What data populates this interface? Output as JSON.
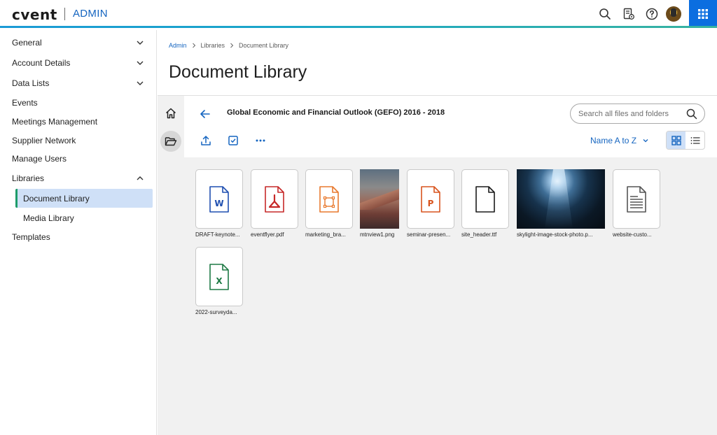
{
  "header": {
    "logo": "cvent",
    "section": "ADMIN",
    "icons": [
      "search-icon",
      "report-settings-icon",
      "help-icon",
      "avatar",
      "apps-grid-icon"
    ]
  },
  "sidebar": {
    "items": [
      {
        "label": "General",
        "expandable": true,
        "expanded": false
      },
      {
        "label": "Account Details",
        "expandable": true,
        "expanded": false
      },
      {
        "label": "Data Lists",
        "expandable": true,
        "expanded": false
      },
      {
        "label": "Events"
      },
      {
        "label": "Meetings Management"
      },
      {
        "label": "Supplier Network"
      },
      {
        "label": "Manage Users"
      },
      {
        "label": "Libraries",
        "expandable": true,
        "expanded": true
      },
      {
        "label": "Templates"
      }
    ],
    "library_children": [
      {
        "label": "Document Library",
        "active": true
      },
      {
        "label": "Media Library",
        "active": false
      }
    ]
  },
  "breadcrumb": [
    "Admin",
    "Libraries",
    "Document Library"
  ],
  "page_title": "Document Library",
  "folder": {
    "title": "Global Economic and Financial Outlook (GEFO) 2016 - 2018",
    "search_placeholder": "Search all files and folders",
    "sort_label": "Name A to Z",
    "view_mode": "grid"
  },
  "files": [
    {
      "name": "DRAFT-keynote...",
      "type": "word",
      "color": "#1f4fb0"
    },
    {
      "name": "eventflyer.pdf",
      "type": "pdf",
      "color": "#c62828"
    },
    {
      "name": "marketing_bra...",
      "type": "vector",
      "color": "#e8792e"
    },
    {
      "name": "mtnview1.png",
      "type": "image-mountain"
    },
    {
      "name": "seminar-presen...",
      "type": "powerpoint",
      "color": "#d9541e"
    },
    {
      "name": "site_header.ttf",
      "type": "generic",
      "color": "#1a1a1a"
    },
    {
      "name": "skylight-image-stock-photo.p...",
      "type": "image-sky"
    },
    {
      "name": "website-custo...",
      "type": "text",
      "color": "#555555"
    },
    {
      "name": "2022-surveyda...",
      "type": "excel",
      "color": "#1e7a45"
    }
  ],
  "colors": {
    "accent": "#1565c0",
    "active_nav_bg": "#cfe0f7",
    "active_nav_marker": "#1d9c6a",
    "apps_button": "#0b6ee0"
  }
}
